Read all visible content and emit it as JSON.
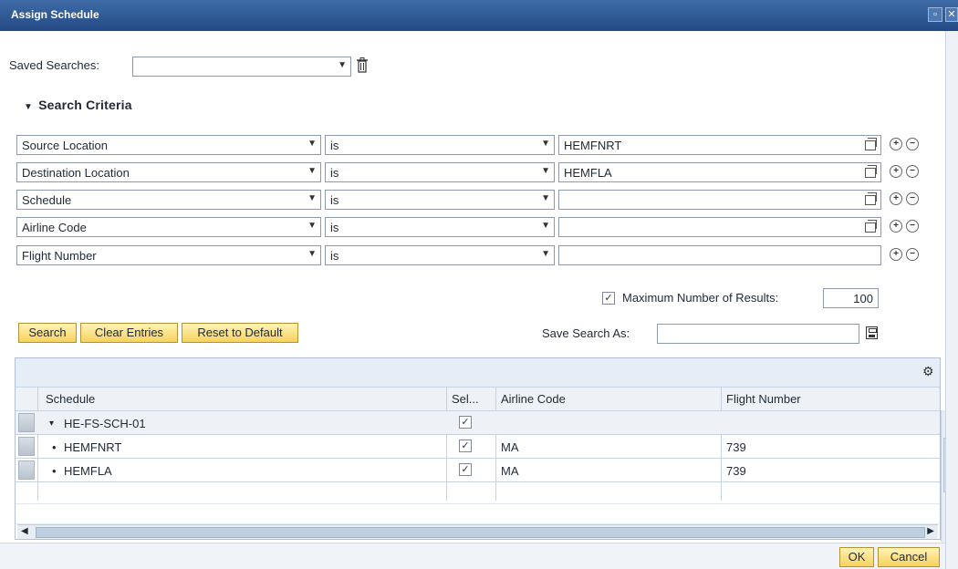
{
  "window": {
    "title": "Assign Schedule",
    "controls": [
      "maximize-icon",
      "close-icon"
    ]
  },
  "saved_searches": {
    "label": "Saved Searches:",
    "value": ""
  },
  "search_criteria": {
    "title": "Search Criteria",
    "rows": [
      {
        "field": "Source Location",
        "operator": "is",
        "value": "HEMFNRT"
      },
      {
        "field": "Destination Location",
        "operator": "is",
        "value": "HEMFLA"
      },
      {
        "field": "Schedule",
        "operator": "is",
        "value": ""
      },
      {
        "field": "Airline Code",
        "operator": "is",
        "value": ""
      },
      {
        "field": "Flight Number",
        "operator": "is",
        "value": ""
      }
    ],
    "max_results_label": "Maximum Number of Results:",
    "max_results_checked": true,
    "max_results_value": "100",
    "save_search_label": "Save Search As:",
    "save_search_value": "",
    "buttons": {
      "search": "Search",
      "clear": "Clear Entries",
      "reset": "Reset to Default"
    }
  },
  "results": {
    "columns": [
      "Schedule",
      "Sel...",
      "Airline Code",
      "Flight Number"
    ],
    "rows": [
      {
        "schedule": "HE-FS-SCH-01",
        "expander": "▾",
        "selected": true,
        "airline": "",
        "flight": ""
      },
      {
        "schedule": "HEMFNRT",
        "expander": "•",
        "selected": true,
        "airline": "MA",
        "flight": "739"
      },
      {
        "schedule": "HEMFLA",
        "expander": "•",
        "selected": true,
        "airline": "MA",
        "flight": "739"
      }
    ]
  },
  "footer": {
    "ok": "OK",
    "cancel": "Cancel"
  },
  "icons": {
    "trash": "trash-icon",
    "copy": "copy-icon",
    "add": "add-icon",
    "remove": "remove-icon",
    "save": "save-icon",
    "personalize": "personalize-icon"
  },
  "colors": {
    "title_bar": "#2b5591",
    "button_yellow": "#f7d25f",
    "grid_header": "#eef2f7"
  }
}
